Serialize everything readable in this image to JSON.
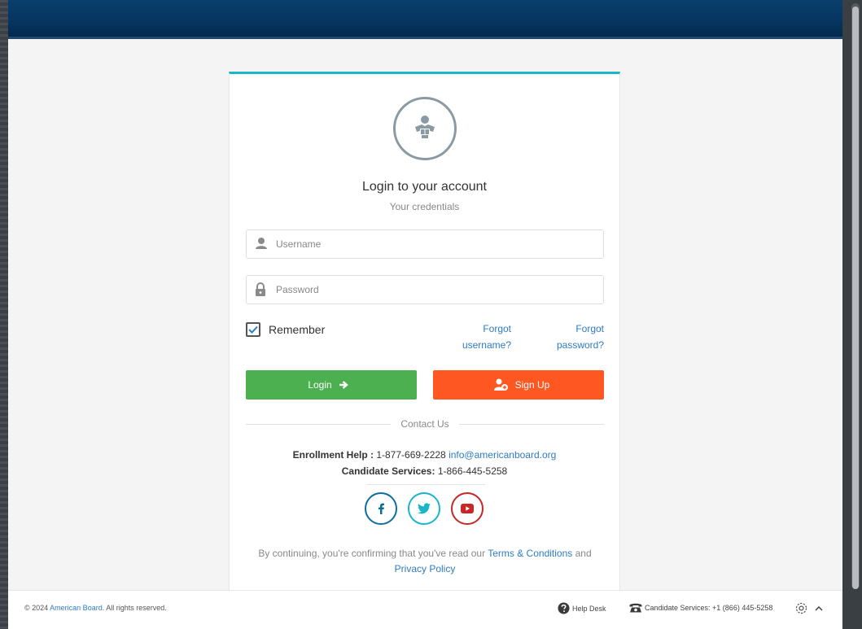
{
  "login": {
    "title": "Login to your account",
    "subtitle": "Your credentials",
    "username_placeholder": "Username",
    "password_placeholder": "Password",
    "remember_label": "Remember",
    "remember_checked": true,
    "forgot_username_line1": "Forgot",
    "forgot_username_line2": "username?",
    "forgot_password_line1": "Forgot",
    "forgot_password_line2": "password?",
    "login_button": "Login",
    "signup_button": "Sign Up"
  },
  "contact": {
    "heading": "Contact Us",
    "enrollment_label": "Enrollment Help :",
    "enrollment_phone": "1-877-669-2228",
    "enrollment_email": "info@americanboard.org",
    "candidate_label": "Candidate Services:",
    "candidate_phone": "1-866-445-5258"
  },
  "social": {
    "facebook": {
      "icon": "facebook-icon",
      "color": "#0d6e9c"
    },
    "twitter": {
      "icon": "twitter-icon",
      "color": "#1bb5c9"
    },
    "youtube": {
      "icon": "youtube-icon",
      "color": "#c62828"
    }
  },
  "terms": {
    "prefix": "By continuing, you're confirming that you've read our",
    "terms_link": "Terms & Conditions",
    "and": "and",
    "privacy_link": "Privacy Policy"
  },
  "footer": {
    "copyright_prefix": "© 2024",
    "brand": "American Board",
    "copyright_suffix": ". All rights reserved.",
    "help_desk": "Help Desk",
    "candidate_services": "Candidate Services: +1 (866) 445-5258"
  },
  "colors": {
    "topbar": "#063560",
    "accent": "#1bb5c9",
    "login": "#4caf50",
    "signup": "#ff5722",
    "link": "#2e7bc4"
  }
}
